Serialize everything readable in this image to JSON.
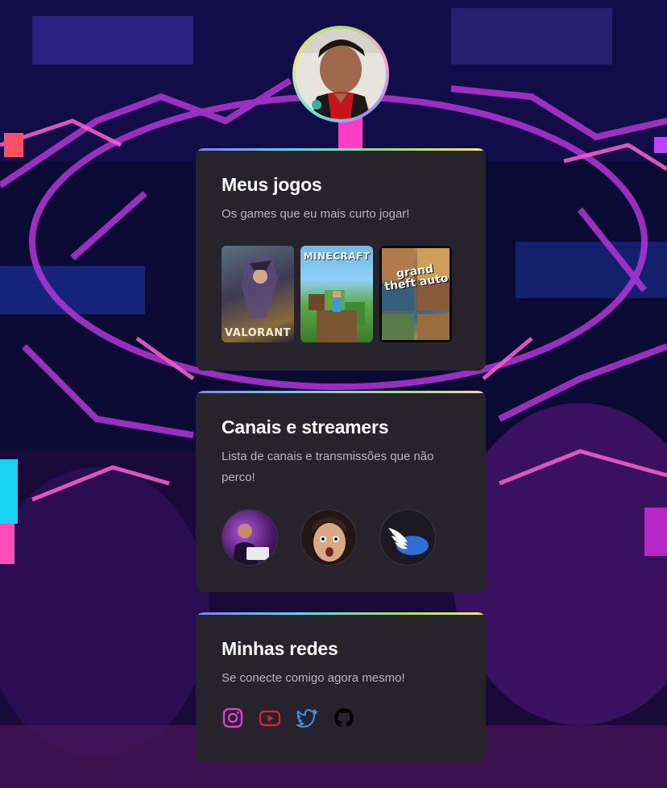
{
  "profile": {
    "avatar_alt": "Foto de perfil"
  },
  "games_section": {
    "title": "Meus jogos",
    "subtitle": "Os games que eu mais curto jogar!",
    "games": [
      {
        "name": "VALORANT"
      },
      {
        "name": "MINECRAFT"
      },
      {
        "name": "Grand Theft Auto V",
        "caption": "grand theft auto"
      }
    ]
  },
  "channels_section": {
    "title": "Canais e streamers",
    "subtitle": "Lista de canais e transmissões que não perco!",
    "channels": [
      {
        "icon": "streamer-avatar-1"
      },
      {
        "icon": "streamer-avatar-2"
      },
      {
        "icon": "winged-logo-avatar"
      }
    ]
  },
  "social_section": {
    "title": "Minhas redes",
    "subtitle": "Se conecte comigo agora mesmo!",
    "links": [
      {
        "icon": "instagram-icon",
        "color": "#d93fd0"
      },
      {
        "icon": "youtube-icon",
        "color": "#e0212b"
      },
      {
        "icon": "twitter-icon",
        "color": "#3d8ef0"
      },
      {
        "icon": "github-icon",
        "color": "#000000"
      }
    ]
  },
  "colors": {
    "card_bg": "#26232d",
    "title": "#ffffff",
    "subtitle": "#b8b3c2"
  }
}
